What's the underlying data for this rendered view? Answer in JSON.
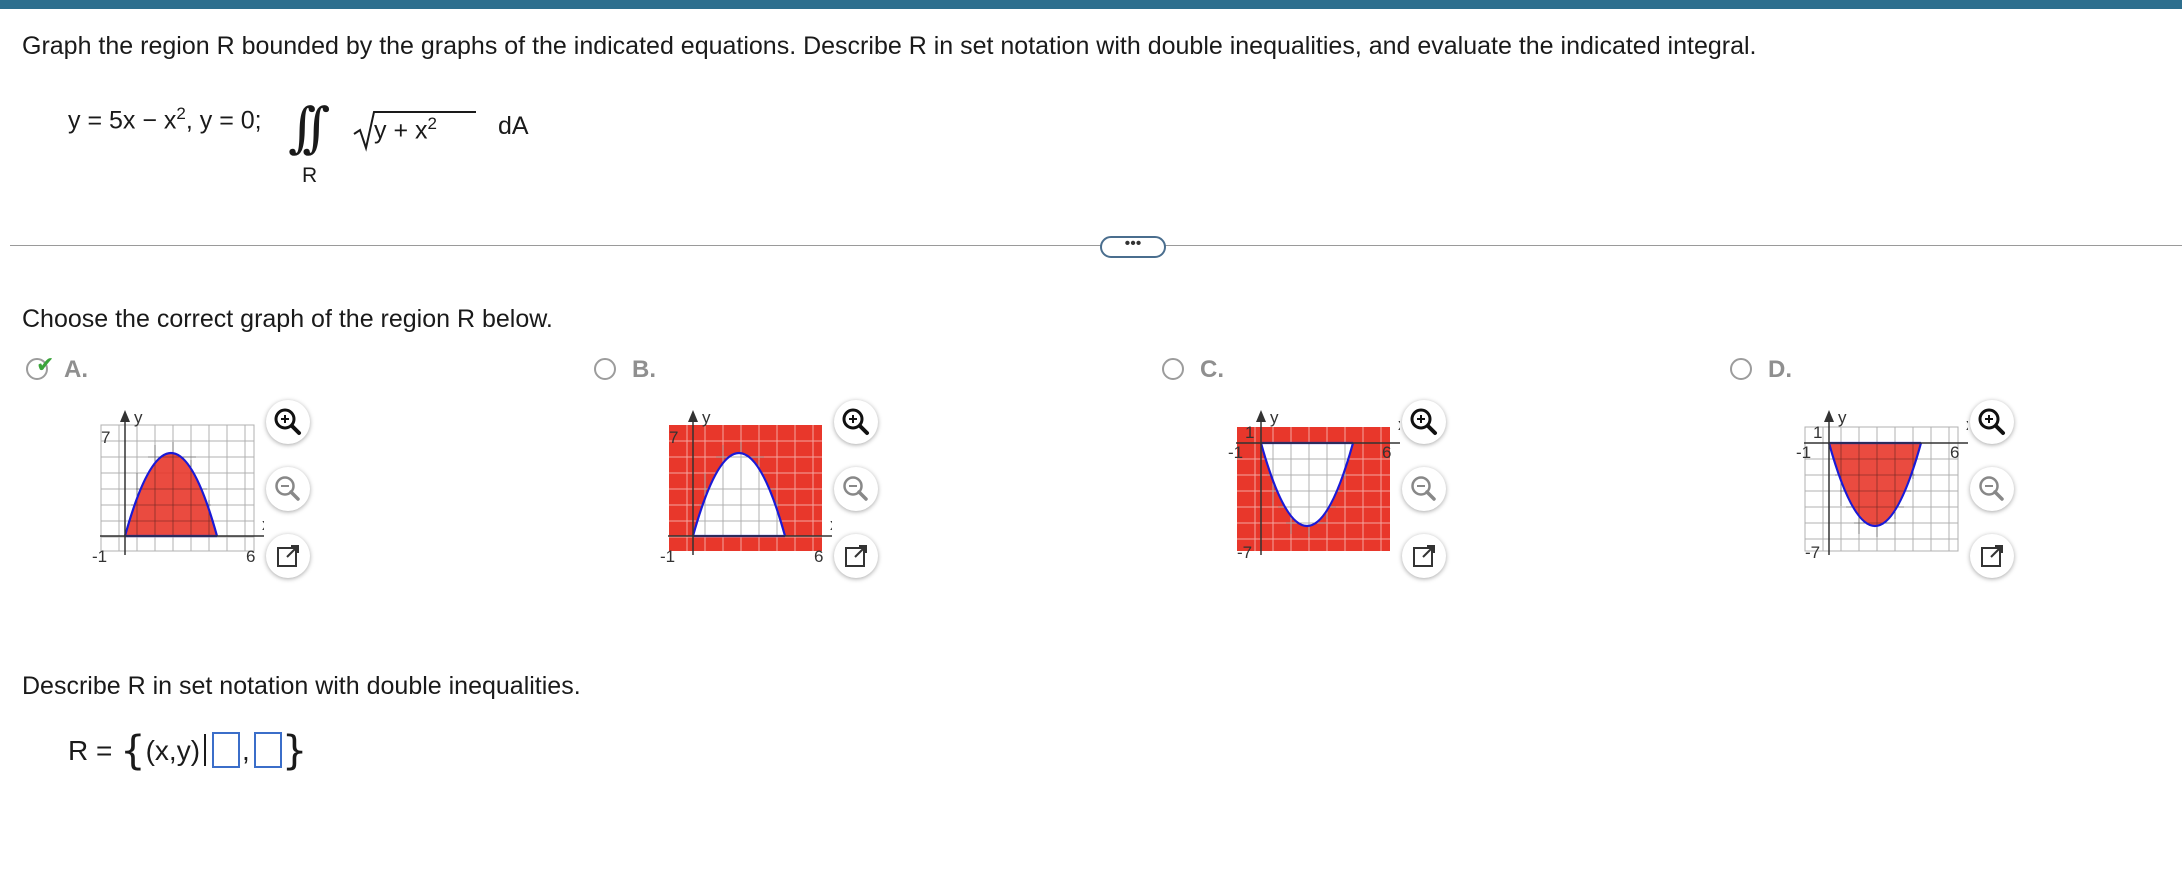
{
  "question": "Graph the region R bounded by the graphs of the indicated equations.  Describe R in set notation with double inequalities, and evaluate the indicated integral.",
  "equations": "y = 5x − x², y = 0;",
  "equation_parts": {
    "pre": "y = 5x − x",
    "exp": "2",
    "post": ", y = 0;"
  },
  "integral": {
    "signs": "∫∫",
    "subscript": "R",
    "radicand_pre": "y + x",
    "radicand_exp": "2",
    "differential": "dA"
  },
  "more_button_label": "•••",
  "prompt_graph": "Choose the correct graph of the region R below.",
  "options": [
    {
      "label": "A.",
      "selected": true,
      "axis": {
        "y_label": "y",
        "x_label": "x",
        "y_top": "7",
        "y_bottom": "-1",
        "x_left": "-1",
        "x_right": "6"
      }
    },
    {
      "label": "B.",
      "selected": false,
      "axis": {
        "y_label": "y",
        "x_label": "x",
        "y_top": "7",
        "y_bottom": "-1",
        "x_left": "-1",
        "x_right": "6"
      }
    },
    {
      "label": "C.",
      "selected": false,
      "axis": {
        "y_label": "y",
        "x_label": "x",
        "y_top": "1",
        "y_bottom": "-7",
        "x_left": "-1",
        "x_right": "6"
      }
    },
    {
      "label": "D.",
      "selected": false,
      "axis": {
        "y_label": "y",
        "x_label": "x",
        "y_top": "1",
        "y_bottom": "-7",
        "x_left": "-1",
        "x_right": "6"
      }
    }
  ],
  "tools": [
    "zoom-in-icon",
    "zoom-out-icon",
    "popout-icon"
  ],
  "prompt_set": "Describe R in set notation with double inequalities.",
  "answer": {
    "prefix": "R = ",
    "brace_open": "{",
    "var": "(x,y)",
    "comma": ",",
    "brace_close": "}"
  },
  "colors": {
    "fill": "#e8372b",
    "curve": "#1a1ad6",
    "accent": "#2e6f8e",
    "check": "#3aa43a"
  }
}
